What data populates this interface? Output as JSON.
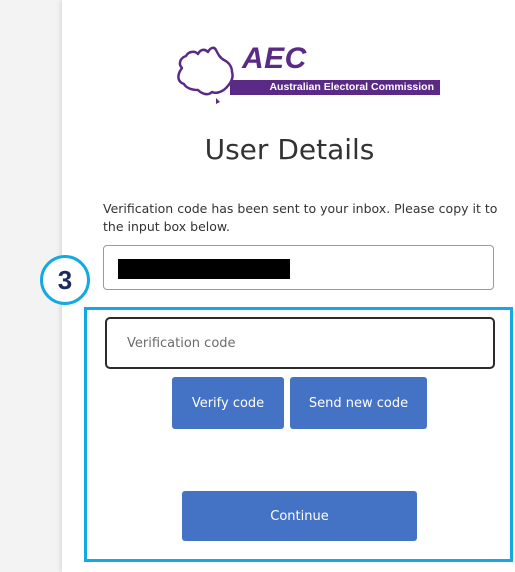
{
  "logo": {
    "abbreviation": "AEC",
    "organization": "Australian Electoral Commission",
    "map_icon": "australia-map-icon",
    "brand_color": "#5b2a86"
  },
  "page": {
    "title": "User Details",
    "info_text": "Verification code has been sent to your inbox. Please copy it to the input box below."
  },
  "email_field": {
    "value": ""
  },
  "annotation": {
    "step_number": "3",
    "color": "#14a9e1"
  },
  "verification_input": {
    "value": "",
    "placeholder": "Verification code"
  },
  "buttons": {
    "verify_label": "Verify code",
    "send_new_label": "Send new code",
    "continue_label": "Continue",
    "color": "#4472c4"
  }
}
